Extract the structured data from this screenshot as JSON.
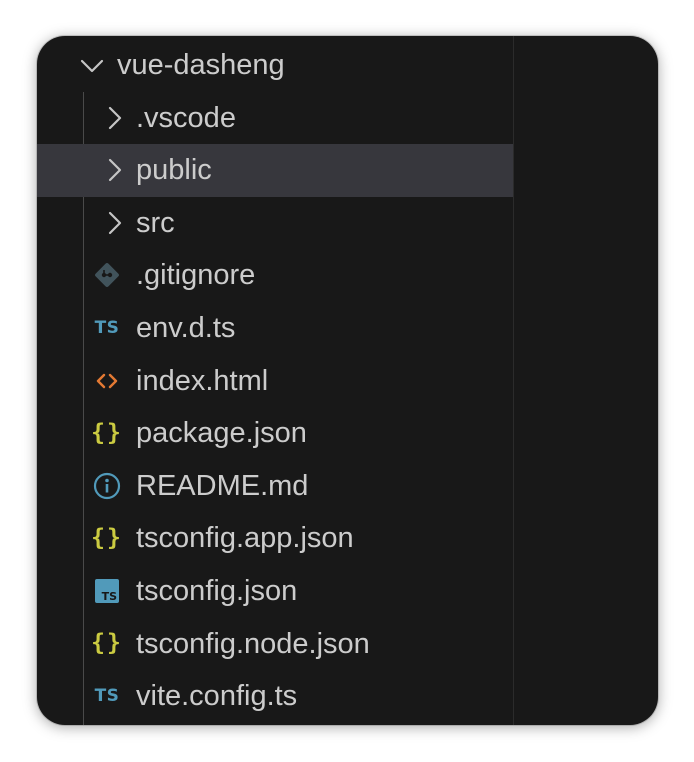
{
  "explorer": {
    "root": {
      "name": "vue-dasheng",
      "expanded": true,
      "icon": "chevron-down-icon"
    },
    "items": [
      {
        "name": ".vscode",
        "type": "folder",
        "icon": "chevron-right-icon",
        "hover": false
      },
      {
        "name": "public",
        "type": "folder",
        "icon": "chevron-right-icon",
        "hover": true
      },
      {
        "name": "src",
        "type": "folder",
        "icon": "chevron-right-icon",
        "hover": false
      },
      {
        "name": ".gitignore",
        "type": "file",
        "icon": "git-icon"
      },
      {
        "name": "env.d.ts",
        "type": "file",
        "icon": "typescript-icon",
        "icon_text": "TS"
      },
      {
        "name": "index.html",
        "type": "file",
        "icon": "html-icon"
      },
      {
        "name": "package.json",
        "type": "file",
        "icon": "json-icon",
        "icon_text": "{}"
      },
      {
        "name": "README.md",
        "type": "file",
        "icon": "info-icon"
      },
      {
        "name": "tsconfig.app.json",
        "type": "file",
        "icon": "json-icon",
        "icon_text": "{}"
      },
      {
        "name": "tsconfig.json",
        "type": "file",
        "icon": "tsconfig-icon",
        "icon_text": "TS"
      },
      {
        "name": "tsconfig.node.json",
        "type": "file",
        "icon": "json-icon",
        "icon_text": "{}"
      },
      {
        "name": "vite.config.ts",
        "type": "file",
        "icon": "typescript-icon",
        "icon_text": "TS"
      }
    ]
  },
  "colors": {
    "background": "#181818",
    "hover_row": "#37373d",
    "text": "#cccccc",
    "typescript": "#519aba",
    "json": "#cbcb41",
    "html": "#e37933",
    "git": "#41535b",
    "info": "#519aba"
  }
}
